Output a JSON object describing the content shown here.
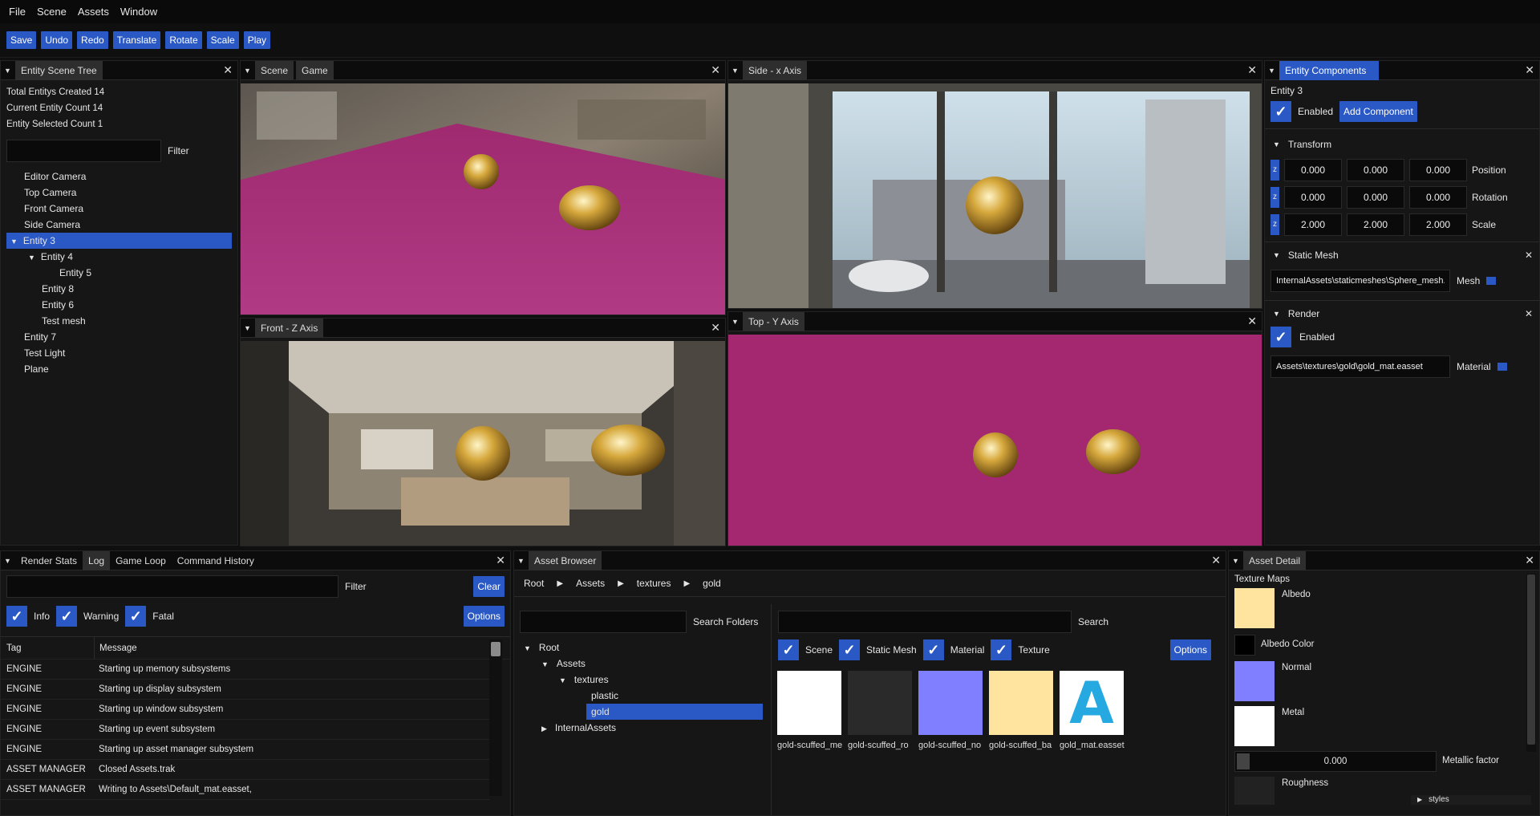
{
  "menu": [
    "File",
    "Scene",
    "Assets",
    "Window"
  ],
  "toolbar": [
    "Save",
    "Undo",
    "Redo",
    "Translate",
    "Rotate",
    "Scale",
    "Play"
  ],
  "scene_tree": {
    "title": "Entity Scene Tree",
    "stats": [
      "Total Entitys Created 14",
      "Current Entity Count 14",
      "Entity Selected Count 1"
    ],
    "filter_label": "Filter",
    "items": [
      "Editor Camera",
      "Top Camera",
      "Front Camera",
      "Side Camera",
      "Entity 3",
      "Entity 4",
      "Entity 5",
      "Entity 8",
      "Entity 6",
      "Test mesh",
      "Entity 7",
      "Test Light",
      "Plane"
    ]
  },
  "viewports": {
    "scene_tab": "Scene",
    "game_tab": "Game",
    "side_tab": "Side - x Axis",
    "front_tab": "Front - Z Axis",
    "top_tab": "Top - Y Axis"
  },
  "components": {
    "title": "Entity Components",
    "entity_name": "Entity 3",
    "enabled_label": "Enabled",
    "add_component": "Add Component",
    "transform_header": "Transform",
    "axis_letter": "z",
    "position": [
      "0.000",
      "0.000",
      "0.000"
    ],
    "position_label": "Position",
    "rotation": [
      "0.000",
      "0.000",
      "0.000"
    ],
    "rotation_label": "Rotation",
    "scale": [
      "2.000",
      "2.000",
      "2.000"
    ],
    "scale_label": "Scale",
    "static_mesh_header": "Static Mesh",
    "mesh_path": "InternalAssets\\staticmeshes\\Sphere_mesh.",
    "mesh_label": "Mesh",
    "render_header": "Render",
    "render_enabled": "Enabled",
    "material_path": "Assets\\textures\\gold\\gold_mat.easset",
    "material_label": "Material"
  },
  "bottom_left": {
    "tabs": [
      "Render Stats",
      "Log",
      "Game Loop",
      "Command History"
    ],
    "filter_label": "Filter",
    "clear": "Clear",
    "checks": [
      "Info",
      "Warning",
      "Fatal"
    ],
    "options": "Options",
    "col_tag": "Tag",
    "col_message": "Message",
    "rows": [
      {
        "tag": "ENGINE",
        "msg": "Starting up memory subsystems"
      },
      {
        "tag": "ENGINE",
        "msg": "Starting up display subsystem"
      },
      {
        "tag": "ENGINE",
        "msg": "Starting up window subsystem"
      },
      {
        "tag": "ENGINE",
        "msg": "Starting up event subsystem"
      },
      {
        "tag": "ENGINE",
        "msg": "Starting up asset manager subsystem"
      },
      {
        "tag": "ASSET MANAGER",
        "msg": "Closed Assets.trak"
      },
      {
        "tag": "ASSET MANAGER",
        "msg": "Writing to Assets\\Default_mat.easset,"
      }
    ]
  },
  "asset_browser": {
    "title": "Asset Browser",
    "breadcrumb": [
      "Root",
      "Assets",
      "textures",
      "gold"
    ],
    "search_folders": "Search Folders",
    "search": "Search",
    "filters": [
      "Scene",
      "Static Mesh",
      "Material",
      "Texture"
    ],
    "options": "Options",
    "folders": [
      "Root",
      "Assets",
      "textures",
      "plastic",
      "gold",
      "InternalAssets"
    ],
    "files": [
      "gold-scuffed_me",
      "gold-scuffed_ro",
      "gold-scuffed_no",
      "gold-scuffed_ba",
      "gold_mat.easset"
    ],
    "file_colors": [
      "#ffffff",
      "#2a2a2a",
      "#7f7fff",
      "#ffe4a0",
      "#ffffff"
    ],
    "material_letter": "A"
  },
  "asset_detail": {
    "title": "Asset Detail",
    "texture_maps": "Texture Maps",
    "albedo": "Albedo",
    "albedo_color": "Albedo Color",
    "normal": "Normal",
    "metal": "Metal",
    "metallic_value": "0.000",
    "metallic_factor": "Metallic factor",
    "roughness": "Roughness",
    "styles_fragment": "styles"
  }
}
